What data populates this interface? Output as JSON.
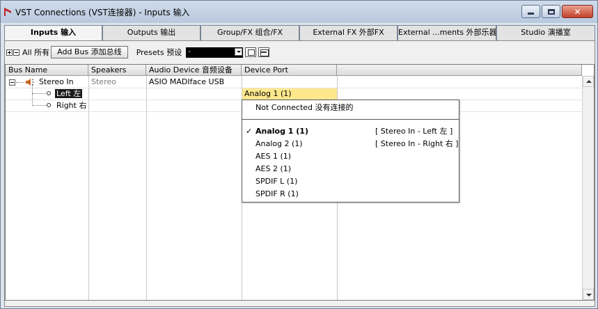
{
  "window": {
    "title": "VST Connections (VST连接器) - Inputs 输入"
  },
  "tabs": [
    {
      "label": "Inputs 输入",
      "active": true
    },
    {
      "label": "Outputs 输出",
      "active": false
    },
    {
      "label": "Group/FX 组合/FX",
      "active": false
    },
    {
      "label": "External FX 外部FX",
      "active": false
    },
    {
      "label": "External ...ments 外部乐器",
      "active": false
    },
    {
      "label": "Studio 演播室",
      "active": false
    }
  ],
  "toolbar": {
    "all_label": "All 所有",
    "add_bus_label": "Add Bus 添加总线",
    "presets_label": "Presets 预设",
    "presets_value": "-"
  },
  "grid": {
    "columns": [
      "Bus Name",
      "Speakers",
      "Audio Device 音频设备",
      "Device Port"
    ],
    "bus": {
      "name": "Stereo In",
      "speakers": "Stereo",
      "audio_device": "ASIO MADIface USB"
    },
    "channels": [
      {
        "name": "Left 左",
        "port": "Analog 1 (1)"
      },
      {
        "name": "Right 右",
        "port": ""
      }
    ]
  },
  "port_menu": {
    "not_connected": "Not Connected 没有连接的",
    "items": [
      {
        "label": "Analog 1 (1)",
        "info": "[ Stereo In - Left 左 ]",
        "checked": true
      },
      {
        "label": "Analog 2 (1)",
        "info": "[ Stereo In - Right 右 ]",
        "checked": false
      },
      {
        "label": "AES 1 (1)",
        "info": "",
        "checked": false
      },
      {
        "label": "AES 2 (1)",
        "info": "",
        "checked": false
      },
      {
        "label": "SPDIF L (1)",
        "info": "",
        "checked": false
      },
      {
        "label": "SPDIF R (1)",
        "info": "",
        "checked": false
      }
    ]
  },
  "colors": {
    "selected_port_cell": "#fde88e",
    "app_icon": "#c0202a"
  }
}
